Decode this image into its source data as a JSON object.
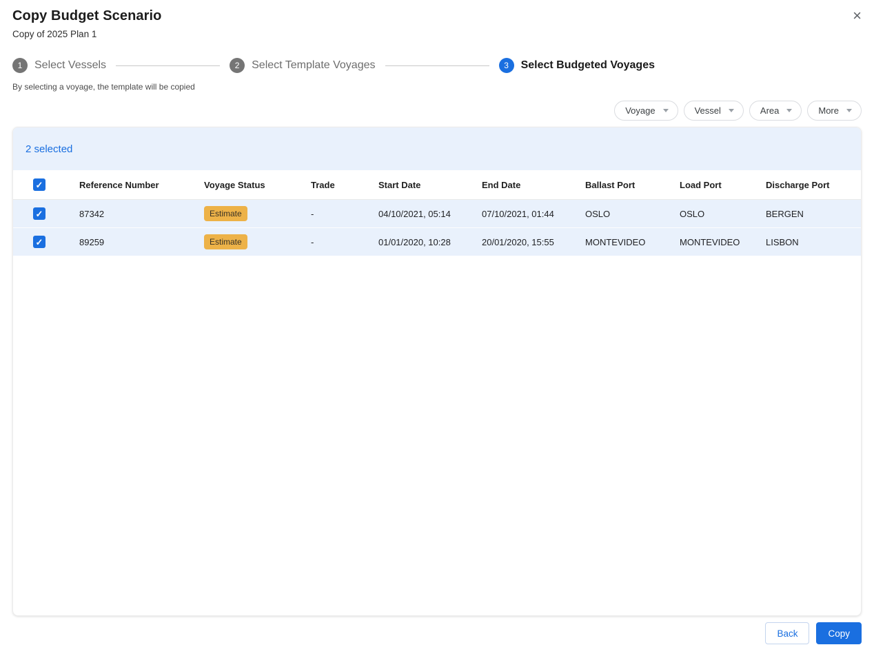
{
  "dialog": {
    "title": "Copy Budget Scenario",
    "subtitle": "Copy of 2025 Plan 1"
  },
  "icons": {
    "close": "×",
    "check": "✓",
    "caret": "chevron-down"
  },
  "stepper": {
    "steps": [
      {
        "number": "1",
        "label": "Select Vessels",
        "active": false
      },
      {
        "number": "2",
        "label": "Select Template Voyages",
        "active": false
      },
      {
        "number": "3",
        "label": "Select Budgeted Voyages",
        "active": true
      }
    ],
    "helper_text": "By selecting a voyage, the template will be copied"
  },
  "filters": [
    {
      "label": "Voyage"
    },
    {
      "label": "Vessel"
    },
    {
      "label": "Area"
    },
    {
      "label": "More"
    }
  ],
  "table": {
    "selected_banner": "2 selected",
    "select_all_checked": true,
    "columns": [
      "Reference Number",
      "Voyage Status",
      "Trade",
      "Start Date",
      "End Date",
      "Ballast Port",
      "Load Port",
      "Discharge Port"
    ],
    "rows": [
      {
        "checked": true,
        "reference_number": "87342",
        "voyage_status": "Estimate",
        "trade": "-",
        "start_date": "04/10/2021, 05:14",
        "end_date": "07/10/2021, 01:44",
        "ballast_port": "OSLO",
        "load_port": "OSLO",
        "discharge_port": "BERGEN"
      },
      {
        "checked": true,
        "reference_number": "89259",
        "voyage_status": "Estimate",
        "trade": "-",
        "start_date": "01/01/2020, 10:28",
        "end_date": "20/01/2020, 15:55",
        "ballast_port": "MONTEVIDEO",
        "load_port": "MONTEVIDEO",
        "discharge_port": "LISBON"
      }
    ]
  },
  "footer": {
    "back_label": "Back",
    "copy_label": "Copy"
  },
  "colors": {
    "primary_blue": "#1a6fe0",
    "banner_bg": "#e9f1fc",
    "selected_row_bg": "#e9f1fc",
    "estimate_badge_bg": "#edb248",
    "estimate_badge_text": "#383125",
    "inactive_step_gray": "#757575",
    "connector_gray": "#c8c8c8"
  }
}
